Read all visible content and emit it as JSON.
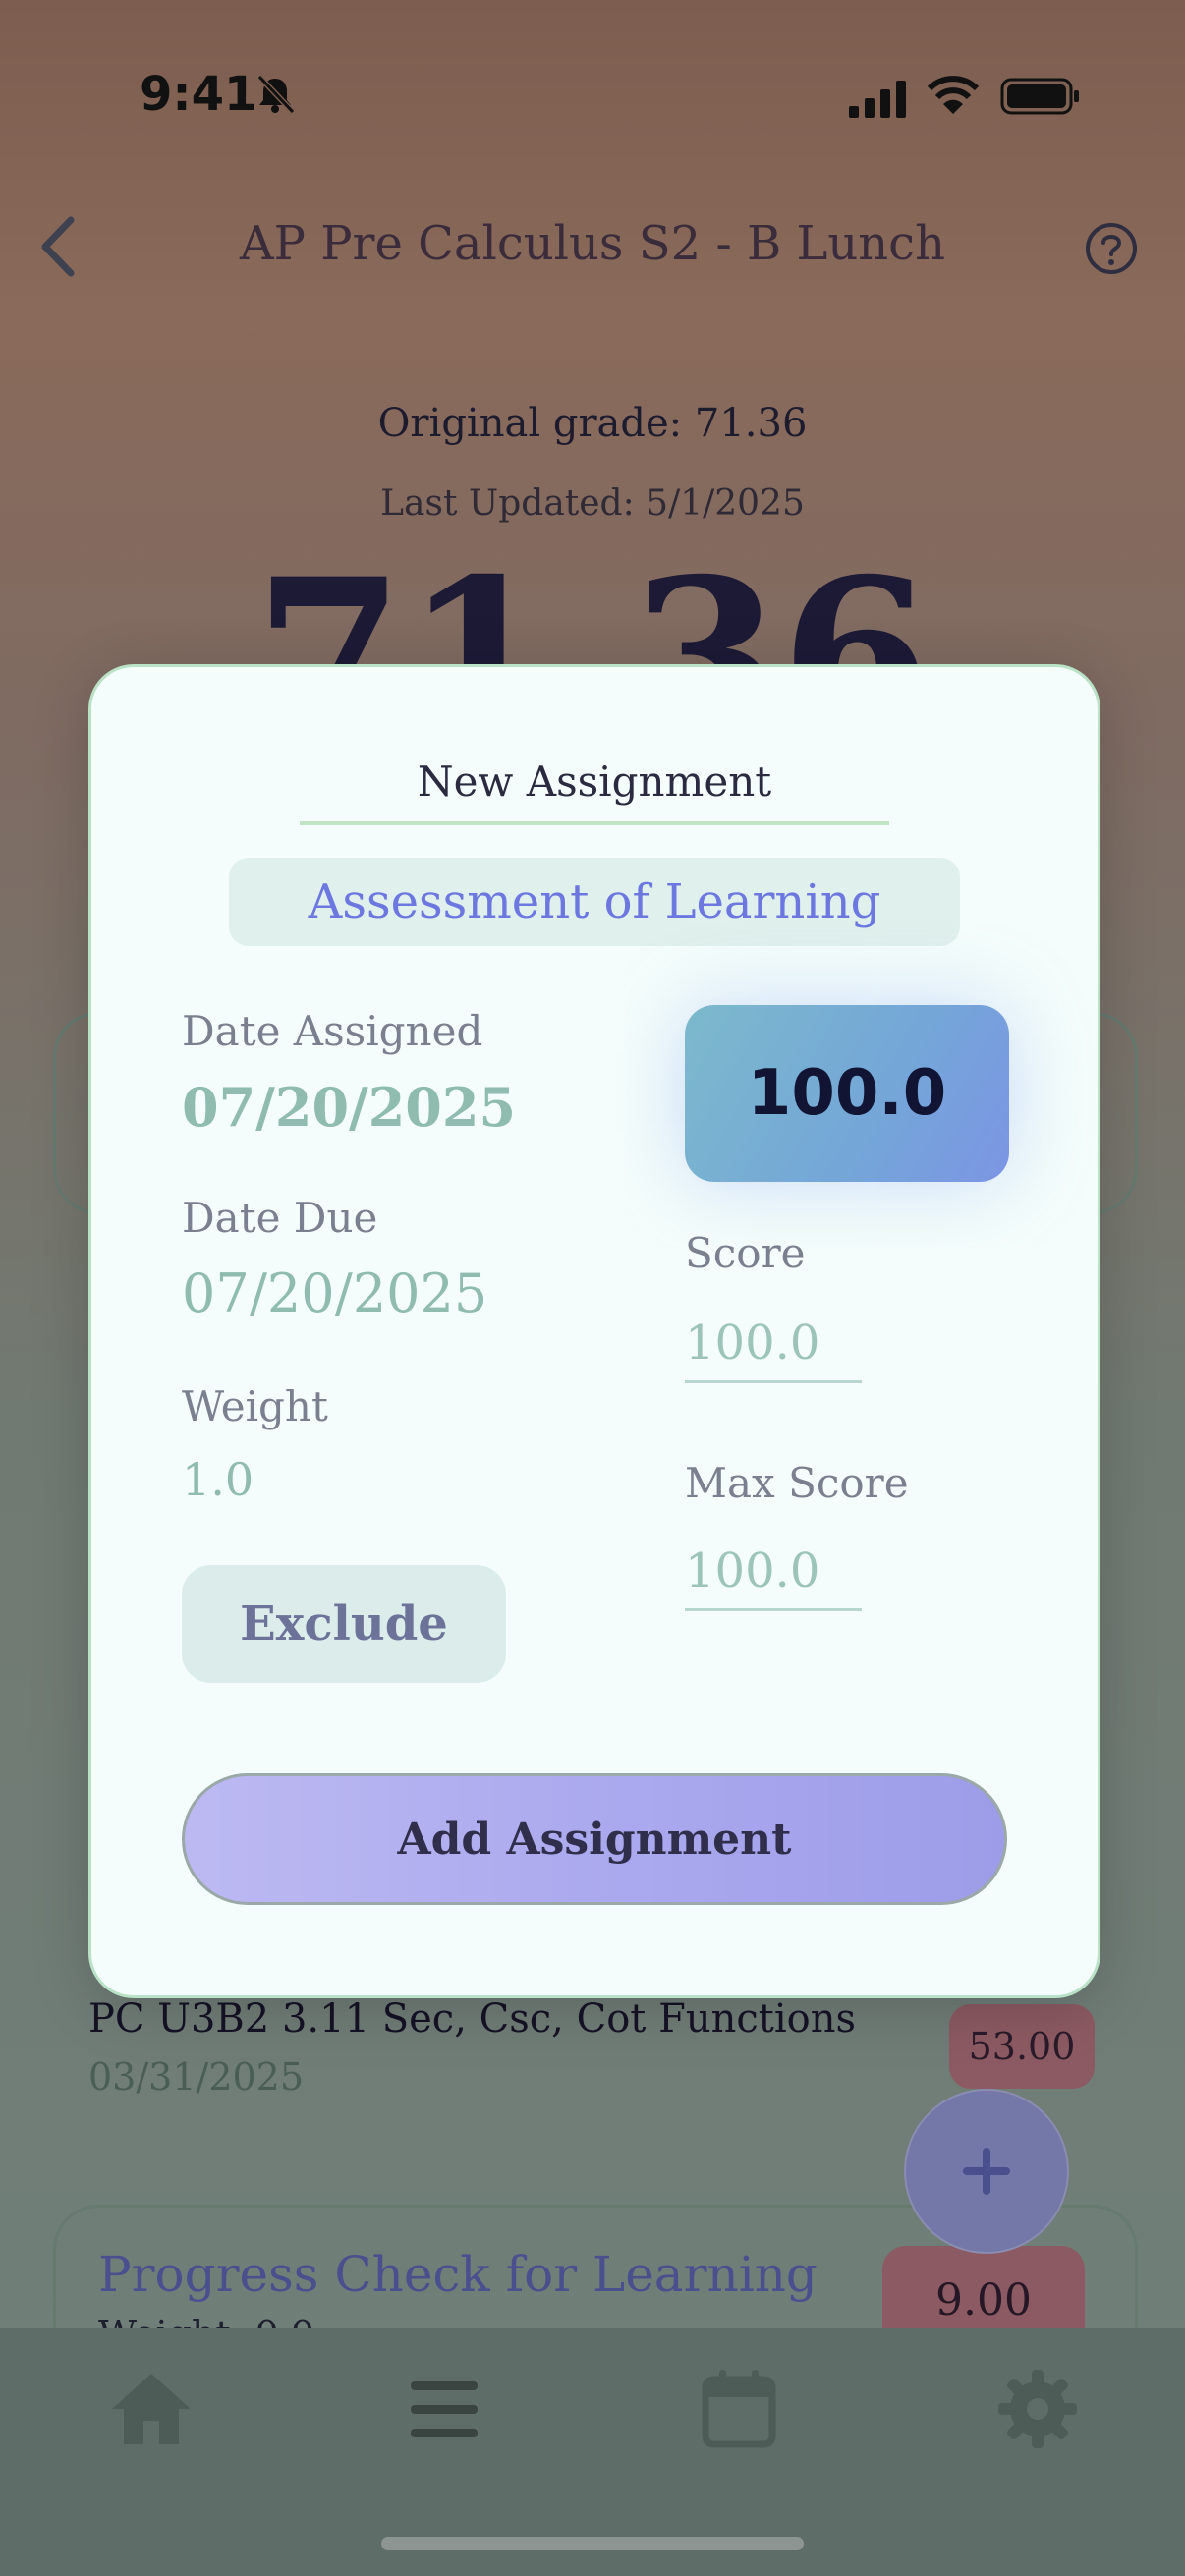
{
  "status_bar": {
    "time": "9:41"
  },
  "header": {
    "title": "AP Pre Calculus S2 - B Lunch"
  },
  "summary": {
    "original_grade": "Original grade: 71.36",
    "last_updated": "Last Updated: 5/1/2025",
    "big_grade": "71.36"
  },
  "assignment_row": {
    "title": "PC U3B2 3.11 Sec, Csc, Cot Functions",
    "date": "03/31/2025",
    "score": "53.00"
  },
  "category_card": {
    "title": "Progress Check for Learning",
    "weight": "Weight: 0.0",
    "score": "9.00"
  },
  "modal": {
    "title": "New Assignment",
    "category": "Assessment of Learning",
    "date_assigned_label": "Date Assigned",
    "date_assigned_value": "07/20/2025",
    "date_due_label": "Date Due",
    "date_due_value": "07/20/2025",
    "weight_label": "Weight",
    "weight_value": "1.0",
    "percent": "100.0",
    "score_label": "Score",
    "score_placeholder": "100.0",
    "max_score_label": "Max Score",
    "max_score_placeholder": "100.0",
    "exclude_label": "Exclude",
    "add_label": "Add Assignment"
  },
  "fab": {
    "icon": "plus-icon"
  },
  "nav": {
    "icons": [
      "home-icon",
      "list-icon",
      "calendar-icon",
      "settings-icon"
    ]
  }
}
